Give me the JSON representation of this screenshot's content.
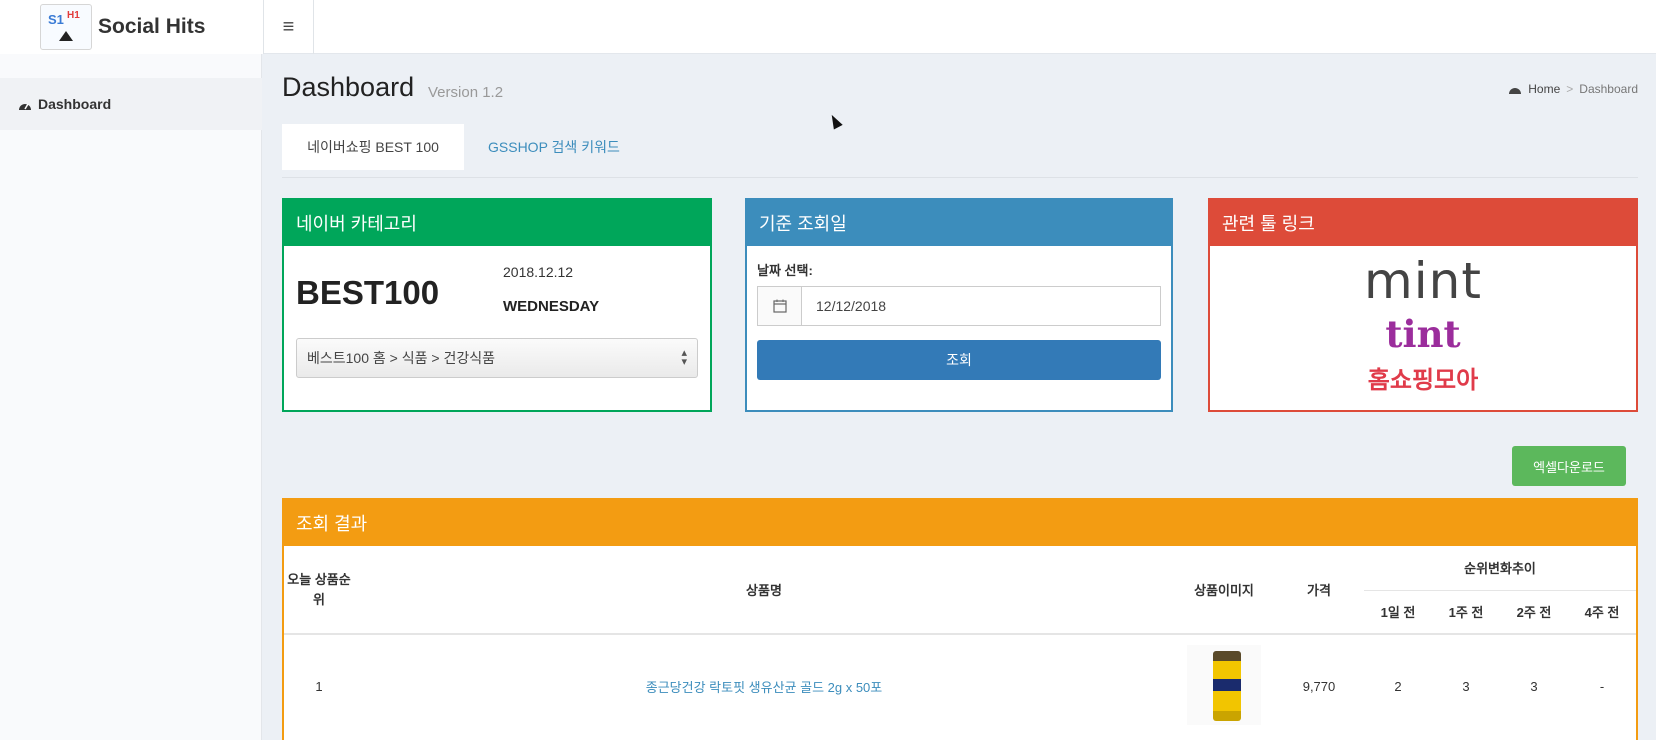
{
  "app": {
    "name": "Social Hits",
    "logo_text_1": "S1",
    "logo_text_2": "H1"
  },
  "sidebar": {
    "items": [
      {
        "label": "Dashboard",
        "icon": "dashboard-icon"
      }
    ]
  },
  "header": {
    "title": "Dashboard",
    "subtitle": "Version 1.2",
    "breadcrumb": {
      "home": "Home",
      "separator": ">",
      "current": "Dashboard"
    }
  },
  "tabs": [
    {
      "label": "네이버쇼핑 BEST 100",
      "active": true
    },
    {
      "label": "GSSHOP 검색 키워드",
      "active": false
    }
  ],
  "naver_box": {
    "title": "네이버 카테고리",
    "best": "BEST100",
    "date": "2018.12.12",
    "weekday": "WEDNESDAY",
    "category_select": "베스트100 홈 > 식품 > 건강식품"
  },
  "date_box": {
    "title": "기준 조회일",
    "label": "날짜 선택:",
    "date_value": "12/12/2018",
    "button": "조회"
  },
  "links_box": {
    "title": "관련 툴 링크",
    "links": [
      "mint",
      "tint",
      "홈쇼핑모아"
    ]
  },
  "excel_button": "엑셀다운로드",
  "results": {
    "title": "조회 결과",
    "headers": {
      "rank": "오늘 상품순위",
      "name": "상품명",
      "image": "상품이미지",
      "price": "가격",
      "trend": "순위변화추이",
      "trend_cols": [
        "1일 전",
        "1주 전",
        "2주 전",
        "4주 전"
      ]
    },
    "rows": [
      {
        "rank": "1",
        "name": "종근당건강 락토핏 생유산균 골드 2g x 50포",
        "price": "9,770",
        "trend": [
          "2",
          "3",
          "3",
          "-"
        ]
      }
    ]
  },
  "colors": {
    "green": "#00a65a",
    "blue": "#3c8dbc",
    "red": "#dd4b39",
    "orange": "#f39c12",
    "excel": "#5cb85c"
  }
}
